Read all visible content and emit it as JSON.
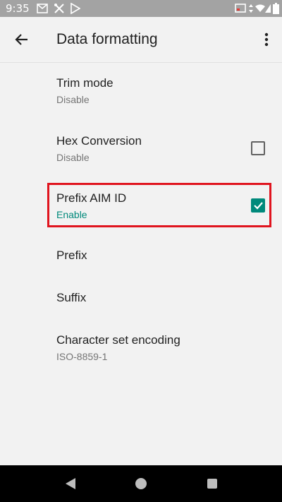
{
  "status_bar": {
    "time": "9:35",
    "left_icons": [
      "mail-icon",
      "tools-icon",
      "play-store-icon"
    ],
    "right_icons": [
      "cast-icon",
      "data-arrows-icon",
      "wifi-icon",
      "signal-icon",
      "battery-icon"
    ]
  },
  "app_bar": {
    "title": "Data formatting",
    "back_icon": "arrow-back-icon",
    "menu_icon": "more-vert-icon"
  },
  "settings": [
    {
      "label": "Trim mode",
      "sub": "Disable",
      "checkbox": null
    },
    {
      "label": "Hex Conversion",
      "sub": "Disable",
      "checkbox": false
    },
    {
      "label": "Prefix AIM ID",
      "sub": "Enable",
      "checkbox": true
    },
    {
      "label": "Prefix",
      "sub": null,
      "checkbox": null
    },
    {
      "label": "Suffix",
      "sub": null,
      "checkbox": null
    },
    {
      "label": "Character set encoding",
      "sub": "ISO-8859-1",
      "checkbox": null
    }
  ],
  "colors": {
    "accent": "#00897b",
    "highlight": "#e0141e",
    "status_bar": "#a3a3a3"
  },
  "nav_bar": {
    "icons": [
      "back-triangle-icon",
      "home-circle-icon",
      "recents-square-icon"
    ]
  }
}
